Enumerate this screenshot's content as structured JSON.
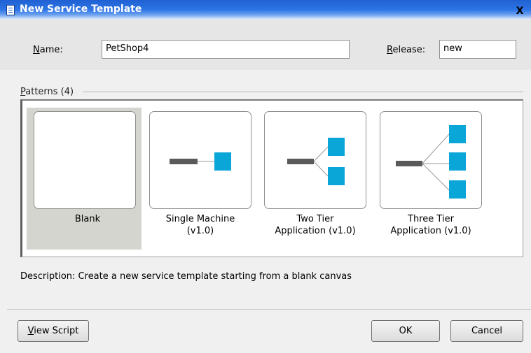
{
  "window": {
    "title": "New Service Template",
    "close_glyph": "X"
  },
  "form": {
    "name_label_first": "N",
    "name_label_rest": "ame:",
    "name_value": "PetShop4",
    "release_label_first": "R",
    "release_label_rest": "elease:",
    "release_value": "new"
  },
  "patterns": {
    "heading_first": "P",
    "heading_rest": "atterns (4)",
    "items": [
      {
        "label": "Blank"
      },
      {
        "label": "Single Machine\n(v1.0)"
      },
      {
        "label": "Two Tier\nApplication (v1.0)"
      },
      {
        "label": "Three Tier\nApplication (v1.0)"
      }
    ]
  },
  "description": "Description:  Create a new service template starting from a blank canvas",
  "buttons": {
    "view_script_first": "V",
    "view_script_rest": "iew Script",
    "ok": "OK",
    "cancel": "Cancel"
  },
  "colors": {
    "accent_node": "#0ba6d8",
    "bar": "#5a5a5a",
    "link": "#9a9a9a"
  }
}
